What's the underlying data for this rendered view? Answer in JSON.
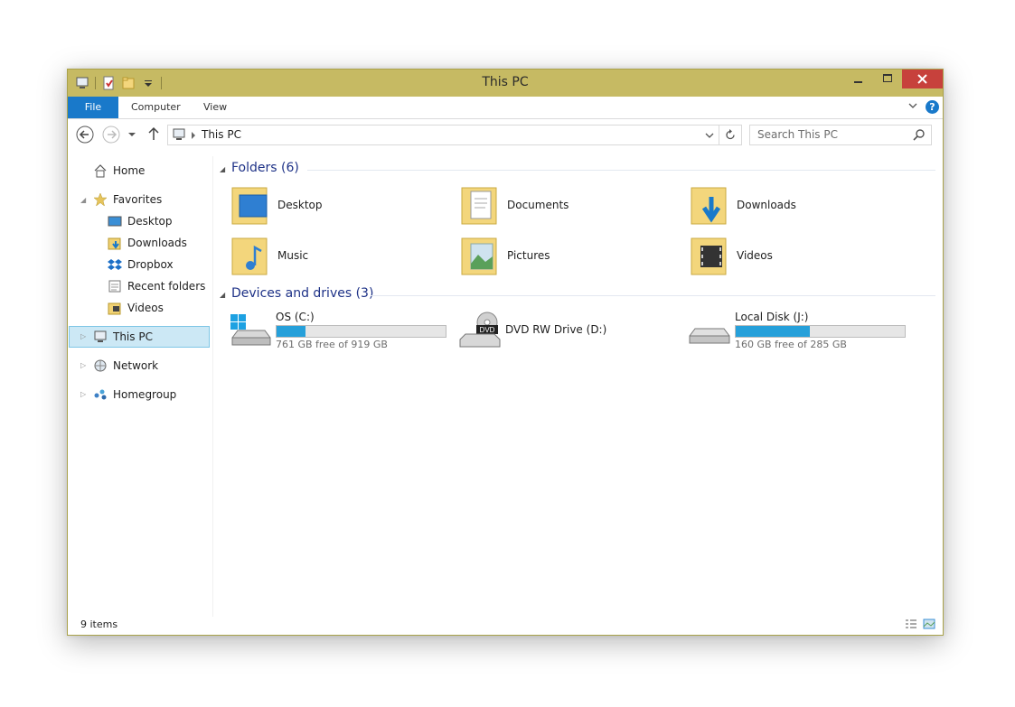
{
  "window": {
    "title": "This PC",
    "accent": "#c6ba63"
  },
  "ribbon": {
    "tabs": [
      "File",
      "Computer",
      "View"
    ]
  },
  "address": {
    "path": "This PC"
  },
  "search": {
    "placeholder": "Search This PC"
  },
  "sidebar": {
    "home": "Home",
    "favorites": "Favorites",
    "fav_items": [
      "Desktop",
      "Downloads",
      "Dropbox",
      "Recent folders",
      "Videos"
    ],
    "this_pc": "This PC",
    "network": "Network",
    "homegroup": "Homegroup"
  },
  "folders": {
    "heading": "Folders (6)",
    "items": [
      "Desktop",
      "Documents",
      "Downloads",
      "Music",
      "Pictures",
      "Videos"
    ]
  },
  "drives": {
    "heading": "Devices and drives (3)",
    "items": [
      {
        "name": "OS (C:)",
        "free": "761 GB free of 919 GB",
        "used_fraction": 0.172
      },
      {
        "name": "DVD RW Drive (D:)"
      },
      {
        "name": "Local Disk (J:)",
        "free": "160 GB free of 285 GB",
        "used_fraction": 0.439
      }
    ]
  },
  "status": {
    "count": "9 items"
  }
}
